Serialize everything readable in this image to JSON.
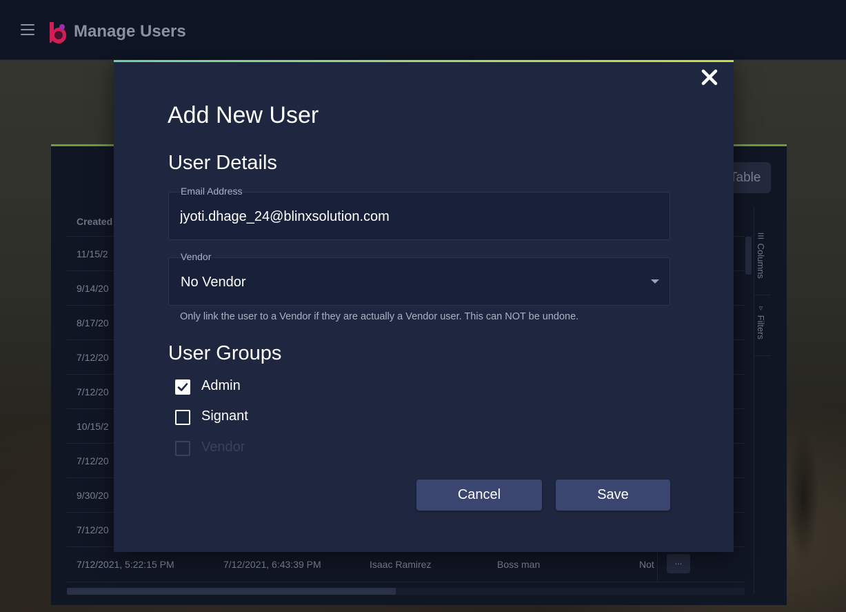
{
  "app": {
    "title": "Manage Users"
  },
  "card": {
    "button_label": "Table"
  },
  "table": {
    "header_first": "Created",
    "rows": [
      {
        "created": "11/15/2"
      },
      {
        "created": "9/14/20"
      },
      {
        "created": "8/17/20"
      },
      {
        "created": "7/12/20"
      },
      {
        "created": "7/12/20"
      },
      {
        "created": "10/15/2"
      },
      {
        "created": "7/12/20"
      },
      {
        "created": "9/30/20"
      },
      {
        "created": "7/12/20"
      }
    ],
    "last_row": {
      "created": "7/12/2021, 5:22:15 PM",
      "updated": "7/12/2021, 6:43:39 PM",
      "name": "Isaac Ramirez",
      "title": "Boss man",
      "status": "Not",
      "more_label": "..."
    },
    "side_tabs": {
      "columns": "Columns",
      "filters": "Filters"
    }
  },
  "modal": {
    "title": "Add New User",
    "user_details_heading": "User Details",
    "email": {
      "label": "Email Address",
      "value": "jyoti.dhage_24@blinxsolution.com"
    },
    "vendor": {
      "label": "Vendor",
      "value": "No Vendor",
      "helper": "Only link the user to a Vendor if they are actually a Vendor user. This can NOT be undone."
    },
    "user_groups_heading": "User Groups",
    "groups": [
      {
        "label": "Admin",
        "checked": true,
        "disabled": false
      },
      {
        "label": "Signant",
        "checked": false,
        "disabled": false
      },
      {
        "label": "Vendor",
        "checked": false,
        "disabled": true
      }
    ],
    "cancel_label": "Cancel",
    "save_label": "Save"
  },
  "colors": {
    "app_bar": "#0f1524",
    "modal_bg": "#1f2740",
    "button_bg": "#3a4670",
    "accent_green": "#7cb342"
  }
}
